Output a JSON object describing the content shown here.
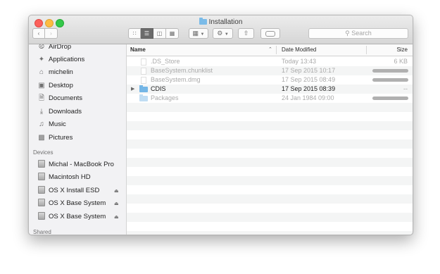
{
  "window": {
    "title": "Installation"
  },
  "toolbar": {
    "back_icon": "chevron-left-icon",
    "forward_icon": "chevron-right-icon",
    "view_buttons": [
      "icon-view",
      "list-view",
      "column-view",
      "cover-flow-view"
    ],
    "active_view": "list-view",
    "arrange_icon": "grid-icon",
    "action_icon": "gear-icon",
    "share_icon": "share-icon",
    "tag_icon": "tag-icon",
    "search": {
      "placeholder": "Search",
      "value": ""
    }
  },
  "sidebar": {
    "favorites": [
      {
        "label": "AirDrop",
        "icon": "airdrop-icon"
      },
      {
        "label": "Applications",
        "icon": "applications-icon"
      },
      {
        "label": "michelin",
        "icon": "home-icon"
      },
      {
        "label": "Desktop",
        "icon": "desktop-icon"
      },
      {
        "label": "Documents",
        "icon": "documents-icon"
      },
      {
        "label": "Downloads",
        "icon": "downloads-icon"
      },
      {
        "label": "Music",
        "icon": "music-icon"
      },
      {
        "label": "Pictures",
        "icon": "pictures-icon"
      }
    ],
    "devices_header": "Devices",
    "devices": [
      {
        "label": "Michal - MacBook Pro",
        "eject": false
      },
      {
        "label": "Macintosh HD",
        "eject": false
      },
      {
        "label": "OS X Install ESD",
        "eject": true
      },
      {
        "label": "OS X Base System",
        "eject": true
      },
      {
        "label": "OS X Base System",
        "eject": true
      }
    ],
    "shared_header": "Shared"
  },
  "list": {
    "columns": {
      "name": "Name",
      "date": "Date Modified",
      "size": "Size"
    },
    "sort_indicator": "^",
    "rows": [
      {
        "name": ".DS_Store",
        "date": "Today 13:43",
        "size": "6 KB",
        "kind": "file",
        "dimmed": true,
        "size_bar": false
      },
      {
        "name": "BaseSystem.chunklist",
        "date": "17 Sep 2015 10:17",
        "size": "",
        "kind": "file",
        "dimmed": true,
        "size_bar": true
      },
      {
        "name": "BaseSystem.dmg",
        "date": "17 Sep 2015 08:49",
        "size": "",
        "kind": "file",
        "dimmed": true,
        "size_bar": true
      },
      {
        "name": "CDIS",
        "date": "17 Sep 2015 08:39",
        "size": "--",
        "kind": "folder",
        "dimmed": false,
        "size_bar": false
      },
      {
        "name": "Packages",
        "date": "24 Jan 1984 09:00",
        "size": "",
        "kind": "folder",
        "dimmed": true,
        "size_bar": true
      }
    ]
  }
}
